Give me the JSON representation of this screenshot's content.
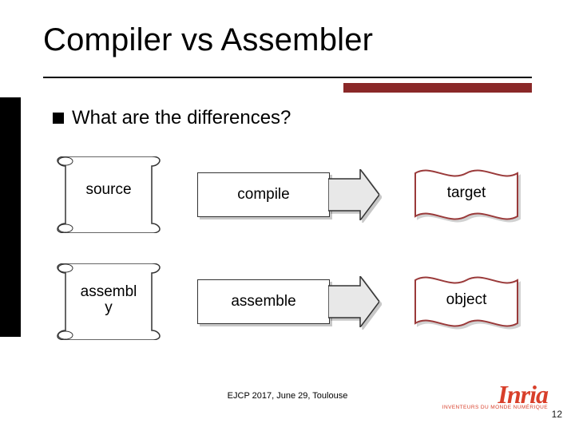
{
  "title": "Compiler vs Assembler",
  "bullet": "What are the differences?",
  "rows": [
    {
      "left": "source",
      "mid": "compile",
      "right": "target"
    },
    {
      "left": "assembl\ny",
      "mid": "assemble",
      "right": "object"
    }
  ],
  "footer": "EJCP 2017, June 29, Toulouse",
  "page": "12",
  "logo": {
    "name": "Inria",
    "tag": "INVENTEURS DU MONDE NUMÉRIQUE"
  },
  "colors": {
    "accent": "#8a2828",
    "logo": "#d83f2a"
  }
}
